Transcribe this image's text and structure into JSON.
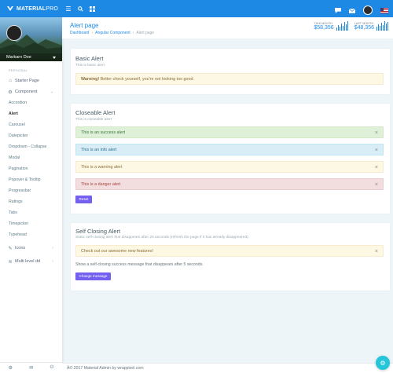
{
  "brand": {
    "bold": "MATERIAL",
    "thin": "PRO"
  },
  "topbar": {
    "menu_icon": "hamburger-icon",
    "search_icon": "search-icon",
    "grid_icon": "grid-icon",
    "message_icon": "message-icon",
    "mail_icon": "mail-icon"
  },
  "profile": {
    "name": "Markarn Doe"
  },
  "sidebar": {
    "section_label": "PERSONAL",
    "starter": "Starter Page",
    "component": "Component",
    "sub_items": [
      "Accordion",
      "Alert",
      "Carousel",
      "Datepicker",
      "Dropdown - Collapse",
      "Modal",
      "Pagination",
      "Popover & Tooltip",
      "Progressbar",
      "Ratings",
      "Tabs",
      "Timepicker",
      "Typehead"
    ],
    "icons": "Icons",
    "multi": "Multi level dd"
  },
  "header": {
    "title": "Alert page",
    "breadcrumbs": [
      "Dashboard",
      "Angular Component",
      "Alert page"
    ],
    "stats": [
      {
        "label": "THIS MONTH",
        "value": "$58,356",
        "bars": [
          4,
          7,
          5,
          9,
          6,
          11,
          8,
          12
        ]
      },
      {
        "label": "LAST MONTH",
        "value": "$48,356",
        "bars": [
          5,
          8,
          6,
          10,
          7,
          12,
          9,
          11
        ]
      }
    ]
  },
  "basic": {
    "title": "Basic Alert",
    "subtitle": "This is basic alert",
    "alert_strong": "Warning!",
    "alert_text": " Better check yourself, you're not looking too good."
  },
  "closeable": {
    "title": "Closeable Alert",
    "subtitle": "This is closeable alert",
    "alerts": [
      "This is an success alert",
      "This is an info alert",
      "This is a warning alert",
      "This is a danger alert"
    ],
    "close": "×",
    "reset": "Reset"
  },
  "selfclosing": {
    "title": "Self Closing Alert",
    "subtitle": "Static self-closing alert that disappears after 20 seconds (refresh the page if it has already disappeared)",
    "alert": "Check out our awesome new features!",
    "close": "×",
    "message": "Show a self-closing success message that disappears after 5 seconds.",
    "button": "Change message"
  },
  "footer": {
    "text": "Â© 2017 Material Admin by wrappixel.com"
  },
  "colors": {
    "primary": "#1e88e5",
    "purple": "#7460ee",
    "cyan": "#26c6da"
  }
}
